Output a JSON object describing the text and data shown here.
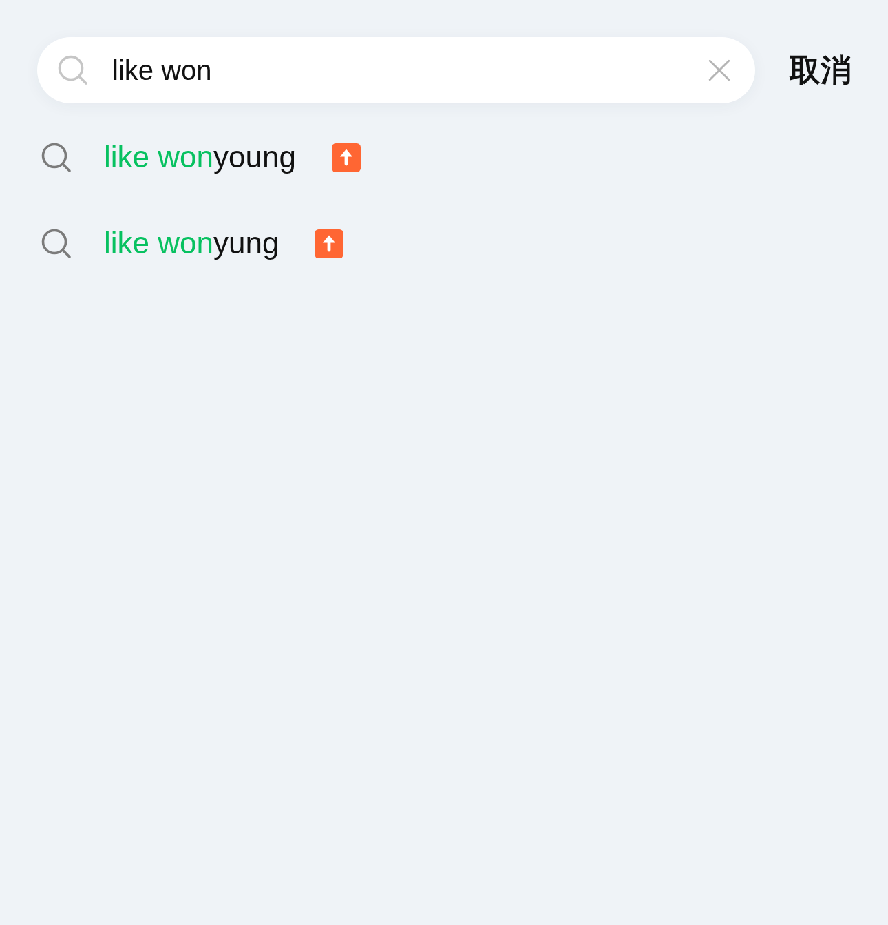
{
  "search": {
    "value": "like won",
    "cancel": "取消"
  },
  "suggestions": [
    {
      "matched": "like won",
      "rest": "young",
      "rising": true
    },
    {
      "matched": "like won",
      "rest": "yung",
      "rising": true
    }
  ]
}
